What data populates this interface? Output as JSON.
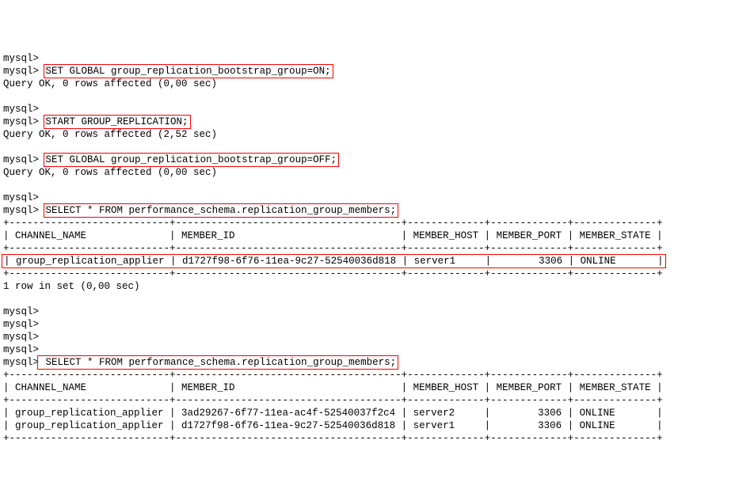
{
  "prompt": "mysql>",
  "blank": "",
  "cmd1": "SET GLOBAL group_replication_bootstrap_group=ON;",
  "ok1": "Query OK, 0 rows affected (0,00 sec)",
  "cmd2": "START GROUP_REPLICATION;",
  "ok2": "Query OK, 0 rows affected (2,52 sec)",
  "cmd3": "SET GLOBAL group_replication_bootstrap_group=OFF;",
  "ok3": "Query OK, 0 rows affected (0,00 sec)",
  "cmd4": "SELECT * FROM performance_schema.replication_group_members;",
  "t1_border": "+---------------------------+--------------------------------------+-------------+-------------+--------------+",
  "t1_header": "| CHANNEL_NAME              | MEMBER_ID                            | MEMBER_HOST | MEMBER_PORT | MEMBER_STATE |",
  "t1_row1": "| group_replication_applier | d1727f98-6f76-11ea-9c27-52540036d818 | server1     |        3306 | ONLINE       |",
  "t1_footer": "1 row in set (0,00 sec)",
  "cmd5_pre": " ",
  "cmd5": "SELECT * FROM performance_schema.replication_group_members;",
  "t2_border": "+---------------------------+--------------------------------------+-------------+-------------+--------------+",
  "t2_header": "| CHANNEL_NAME              | MEMBER_ID                            | MEMBER_HOST | MEMBER_PORT | MEMBER_STATE |",
  "t2_row1": "| group_replication_applier | 3ad29267-6f77-11ea-ac4f-52540037f2c4 | server2     |        3306 | ONLINE       |",
  "t2_row2": "| group_replication_applier | d1727f98-6f76-11ea-9c27-52540036d818 | server1     |        3306 | ONLINE       |"
}
